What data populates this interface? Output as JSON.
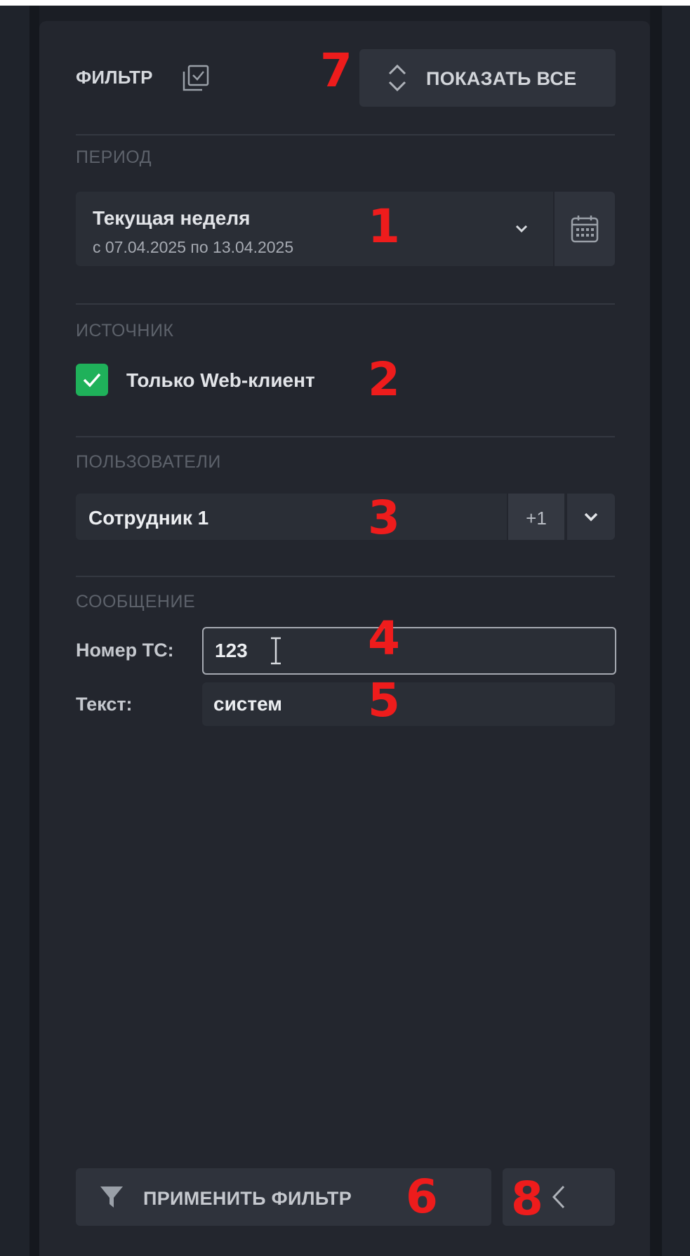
{
  "header": {
    "title": "ФИЛЬТР",
    "show_all_label": "ПОКАЗАТЬ ВСЕ"
  },
  "period": {
    "section_label": "ПЕРИОД",
    "selected": "Текущая неделя",
    "range": "с 07.04.2025 по 13.04.2025"
  },
  "source": {
    "section_label": "ИСТОЧНИК",
    "web_client_only_label": "Только Web-клиент",
    "web_client_only_checked": true
  },
  "users": {
    "section_label": "ПОЛЬЗОВАТЕЛИ",
    "selected": "Сотрудник 1",
    "extra_count": "+1"
  },
  "message": {
    "section_label": "СООБЩЕНИЕ",
    "vehicle_number_label": "Номер ТС:",
    "vehicle_number_value": "123",
    "text_label": "Текст:",
    "text_value": "систем"
  },
  "footer": {
    "apply_label": "ПРИМЕНИТЬ ФИЛЬТР"
  },
  "annotations": [
    "1",
    "2",
    "3",
    "4",
    "5",
    "6",
    "7",
    "8"
  ],
  "colors": {
    "background": "#23262e",
    "checkbox_accent": "#1fb15a",
    "annotation_red": "#ee1c1c"
  },
  "icons": {
    "filter_header": "checkbox-stack-icon",
    "show_all": "expand-vertical-icon",
    "period_dropdown": "chevron-down-icon",
    "calendar": "calendar-icon",
    "checkbox": "checkmark-icon",
    "users_dropdown": "chevron-down-icon",
    "apply": "funnel-icon",
    "collapse": "chevron-left-icon"
  }
}
